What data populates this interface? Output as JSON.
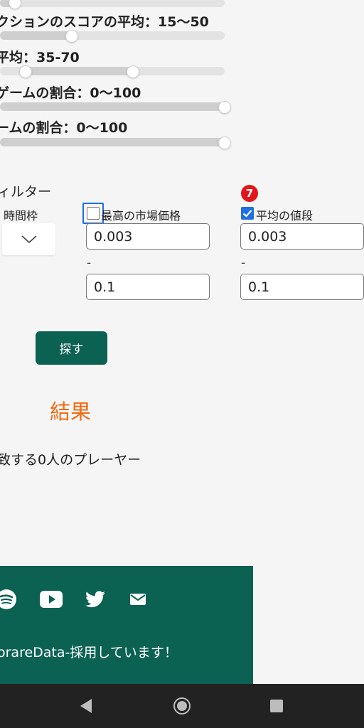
{
  "sliders": [
    {
      "label": "クションのスコアの平均：15〜50",
      "values": [
        15,
        50
      ]
    },
    {
      "label": "平均：35-70",
      "values": [
        35,
        70
      ]
    },
    {
      "label": "ゲームの割合：0〜100",
      "values": [
        0,
        100
      ]
    },
    {
      "label": "ームの割合：0〜100",
      "values": [
        0,
        100
      ]
    }
  ],
  "filter": {
    "title": "ィルター",
    "timeframe_label": "時間枠",
    "max_price": {
      "label": "最高の市場価格",
      "checked": false,
      "min": "0.003",
      "max": "0.1"
    },
    "avg_value": {
      "label": "平均の値段",
      "checked": true,
      "min": "0.003",
      "max": "0.1"
    },
    "dash": "-",
    "badge": "7"
  },
  "search_label": "探す",
  "results": {
    "title": "結果",
    "count_text": "致する0人のプレーヤー"
  },
  "footer": {
    "text": "orareData-採用しています！",
    "icons": [
      "spotify-icon",
      "youtube-icon",
      "twitter-icon",
      "mail-icon"
    ]
  },
  "colors": {
    "accent": "#0b6152",
    "results": "#f06b14",
    "badge": "#e0161b",
    "checkbox": "#1e6fe0"
  }
}
